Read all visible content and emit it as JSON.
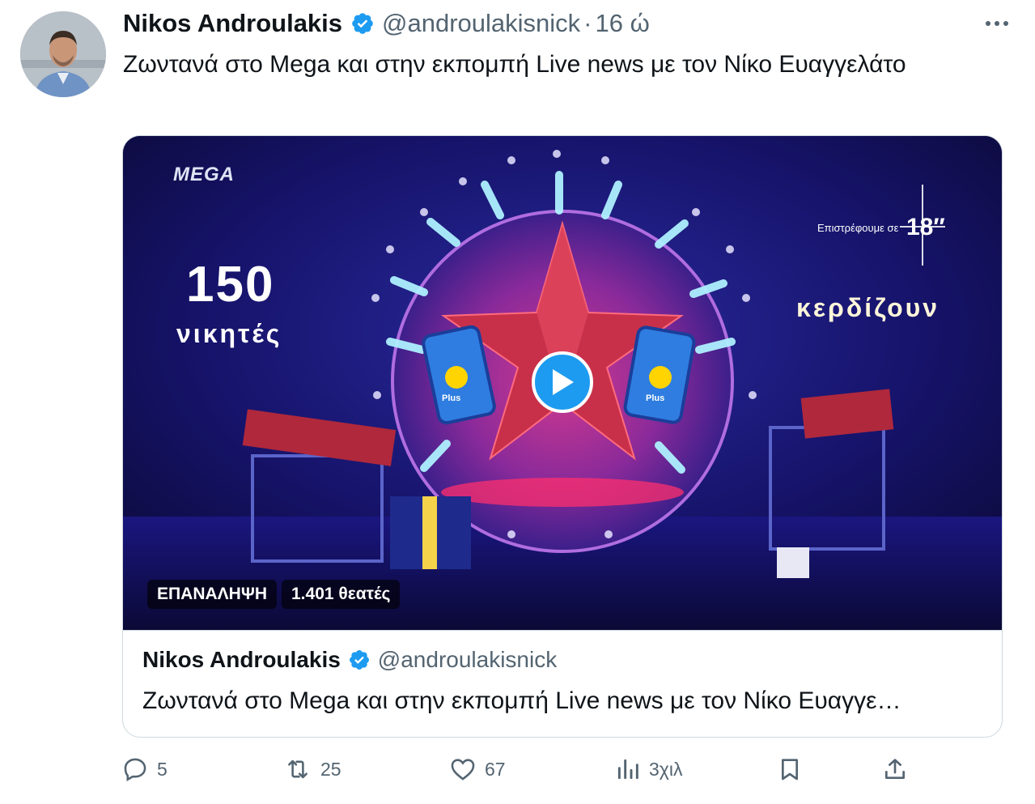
{
  "author": {
    "name": "Nikos Androulakis",
    "handle": "@androulakisnick",
    "separator": "·",
    "time": "16 ώ"
  },
  "tweet": {
    "text": "Ζωντανά στο Mega και στην εκπομπή Live news με τον Νίκο Ευαγγελάτο"
  },
  "media": {
    "channel_logo": "MEGA",
    "big_number": "150",
    "winners_label": "νικητές",
    "win_label": "κερδίζουν",
    "return_label": "Επιστρέφουμε σε",
    "return_value": "18′′",
    "brand_label": "Plus",
    "replay_badge": "ΕΠΑΝΑΛΗΨΗ",
    "viewers_badge": "1.401 θεατές"
  },
  "quote": {
    "name": "Nikos Androulakis",
    "handle": "@androulakisnick",
    "text": "Ζωντανά στο Mega και στην εκπομπή Live news με τον Νίκο Ευαγγε…"
  },
  "actions": {
    "replies": "5",
    "retweets": "25",
    "likes": "67",
    "views": "3χιλ"
  },
  "colors": {
    "verified": "#1d9bf0",
    "secondary_text": "#536471",
    "border": "#cfd9de",
    "play_button": "#1d9bf0"
  },
  "icons": [
    "verified-badge-icon",
    "more-options-icon",
    "play-icon",
    "reply-icon",
    "retweet-icon",
    "like-icon",
    "views-icon",
    "bookmark-icon",
    "share-icon"
  ]
}
